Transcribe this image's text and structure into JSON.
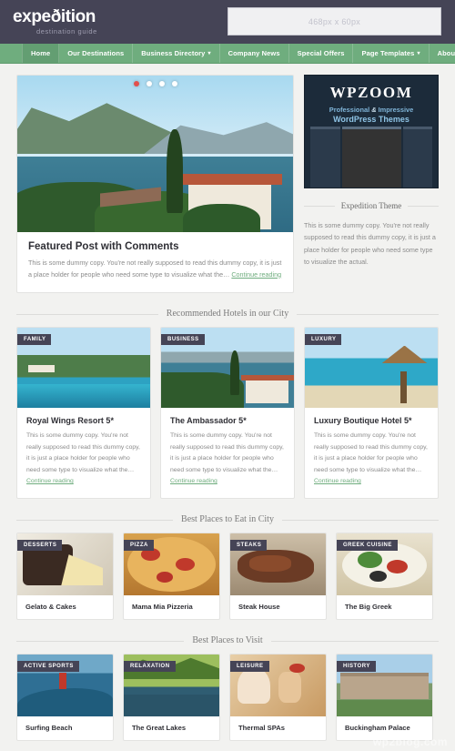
{
  "header": {
    "brand_title": "expeðition",
    "brand_tagline": "destination guide",
    "ad_placeholder": "468px x 60px"
  },
  "nav": {
    "items": [
      {
        "label": "Home",
        "caret": "",
        "active": true
      },
      {
        "label": "Our Destinations",
        "caret": "",
        "active": false
      },
      {
        "label": "Business Directory",
        "caret": "▾",
        "active": false
      },
      {
        "label": "Company News",
        "caret": "",
        "active": false
      },
      {
        "label": "Special Offers",
        "caret": "",
        "active": false
      },
      {
        "label": "Page Templates",
        "caret": "▾",
        "active": false
      },
      {
        "label": "About Us",
        "caret": "▾",
        "active": false
      }
    ]
  },
  "featured": {
    "title": "Featured Post with Comments",
    "excerpt": "This is some dummy copy. You're not really supposed to read this dummy copy, it is just a place holder for people who need some type to visualize what the…",
    "read_more": "Continue reading",
    "slides": 4,
    "active_slide": 0,
    "active_dot_color": "#e2504d"
  },
  "sidebar": {
    "ad": {
      "title": "WPZOOM",
      "subtitle_pro": "Professional",
      "subtitle_amp": "&",
      "subtitle_imp": "Impressive",
      "subtitle_line2": "WordPress Themes"
    },
    "widget": {
      "title": "Expedition Theme",
      "body": "This is some dummy copy. You're not really supposed to read this dummy copy, it is just a place holder for people who need some type to visualize the actual."
    }
  },
  "sections": [
    {
      "heading": "Recommended Hotels in our City",
      "layout": "grid-3",
      "cards": [
        {
          "badge": "FAMILY",
          "title": "Royal Wings Resort 5*",
          "text": "This is some dummy copy. You're not really supposed to read this dummy copy, it is just a place holder for people who need some type to visualize what the…",
          "read_more": "Continue reading",
          "scene": "bay"
        },
        {
          "badge": "BUSINESS",
          "title": "The Ambassador 5*",
          "text": "This is some dummy copy. You're not really supposed to read this dummy copy, it is just a place holder for people who need some type to visualize what the…",
          "read_more": "Continue reading",
          "scene": "villa"
        },
        {
          "badge": "LUXURY",
          "title": "Luxury Boutique Hotel 5*",
          "text": "This is some dummy copy. You're not really supposed to read this dummy copy, it is just a place holder for people who need some type to visualize what the…",
          "read_more": "Continue reading",
          "scene": "beach"
        }
      ]
    },
    {
      "heading": "Best Places to Eat in City",
      "layout": "grid-4",
      "cards": [
        {
          "badge": "DESSERTS",
          "title": "Gelato & Cakes",
          "scene": "dessert"
        },
        {
          "badge": "PIZZA",
          "title": "Mama Mia Pizzeria",
          "scene": "pizza"
        },
        {
          "badge": "STEAKS",
          "title": "Steak House",
          "scene": "steak"
        },
        {
          "badge": "GREEK CUISINE",
          "title": "The Big Greek",
          "scene": "greek"
        }
      ]
    },
    {
      "heading": "Best Places to Visit",
      "layout": "grid-4",
      "cards": [
        {
          "badge": "ACTIVE SPORTS",
          "title": "Surfing Beach",
          "scene": "surf"
        },
        {
          "badge": "RELAXATION",
          "title": "The Great Lakes",
          "scene": "lake"
        },
        {
          "badge": "LEISURE",
          "title": "Thermal SPAs",
          "scene": "spa"
        },
        {
          "badge": "HISTORY",
          "title": "Buckingham Palace",
          "scene": "palace"
        }
      ]
    }
  ],
  "watermark": "wp2blog.com"
}
